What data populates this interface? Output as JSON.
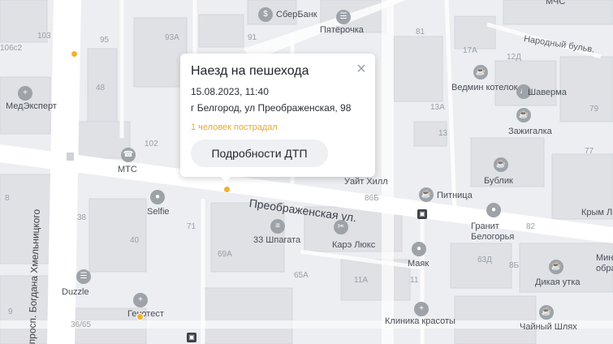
{
  "popup": {
    "title": "Наезд на пешехода",
    "date": "15.08.2023, 11:40",
    "address": "г Белгород, ул Преображенская, 98",
    "injured": "1 человек пострадал",
    "details_button": "Подробности ДТП",
    "close_icon": "close-icon"
  },
  "streets": {
    "preobrazhenskaya": "Преображенская ул.",
    "khmelnitsky": "просп. Богдана Хмельницкого",
    "narodny": "Народный бульв."
  },
  "pois": {
    "sberbank": "СберБанк",
    "pyaterochka": "Пятёрочка",
    "medexpert": "МедЭксперт",
    "mts": "МТС",
    "vedmin": "Ведмин котелок",
    "shaurma": "Шаверма",
    "zazhigalka": "Зажигалка",
    "bublik": "Бублик",
    "uait_hill": "Уайт Хилл",
    "pitnitsa": "Питница",
    "granit": "Гранит Белогорья",
    "krym": "Крым Л",
    "mini": "Мини обра",
    "selfie": "Selfie",
    "shpagata": "33 Шпагата",
    "kare": "Карэ Люкс",
    "mayak": "Маяк",
    "duzzle": "Duzzle",
    "genotest": "Генотест",
    "dikaya": "Дикая утка",
    "klinika": "Клиника красоты",
    "chainy": "Чайный Шлях",
    "mchs": "МЧС"
  },
  "house_numbers": [
    "103",
    "106с2",
    "95",
    "93А",
    "91",
    "81",
    "17А",
    "12Д",
    "48",
    "102",
    "79",
    "13А",
    "13",
    "77",
    "86Б",
    "82",
    "38",
    "40",
    "71",
    "69А",
    "65А",
    "11А",
    "11",
    "63Д",
    "8Б",
    "9",
    "36/65",
    "8"
  ],
  "colors": {
    "marker": "#f3b12f",
    "injured_text": "#e8a92f",
    "button_bg": "#eef0f3"
  }
}
